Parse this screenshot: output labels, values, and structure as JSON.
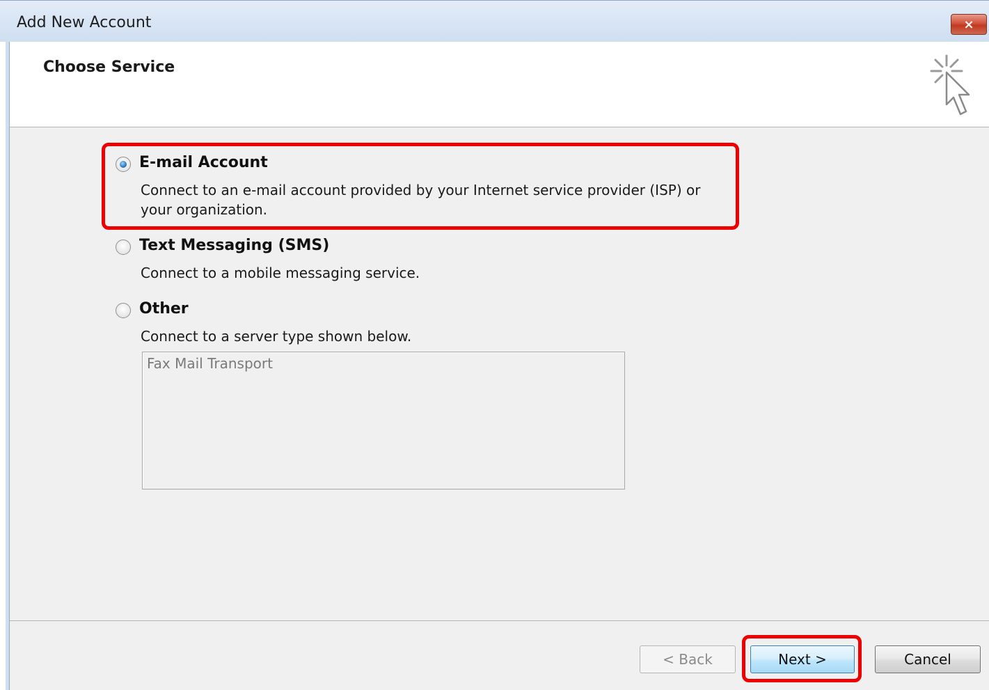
{
  "window": {
    "title": "Add New Account",
    "close_label": "×"
  },
  "header": {
    "title": "Choose Service"
  },
  "options": [
    {
      "label": "E-mail Account",
      "description": "Connect to an e-mail account provided by your Internet service provider (ISP) or your organization.",
      "selected": true
    },
    {
      "label": "Text Messaging (SMS)",
      "description": "Connect to a mobile messaging service.",
      "selected": false
    },
    {
      "label": "Other",
      "description": "Connect to a server type shown below.",
      "selected": false
    }
  ],
  "server_types": [
    "Fax Mail Transport"
  ],
  "buttons": {
    "back": "< Back",
    "next": "Next >",
    "cancel": "Cancel"
  },
  "colors": {
    "highlight": "#ee0000",
    "selected_radio": "#2a7ac0"
  }
}
